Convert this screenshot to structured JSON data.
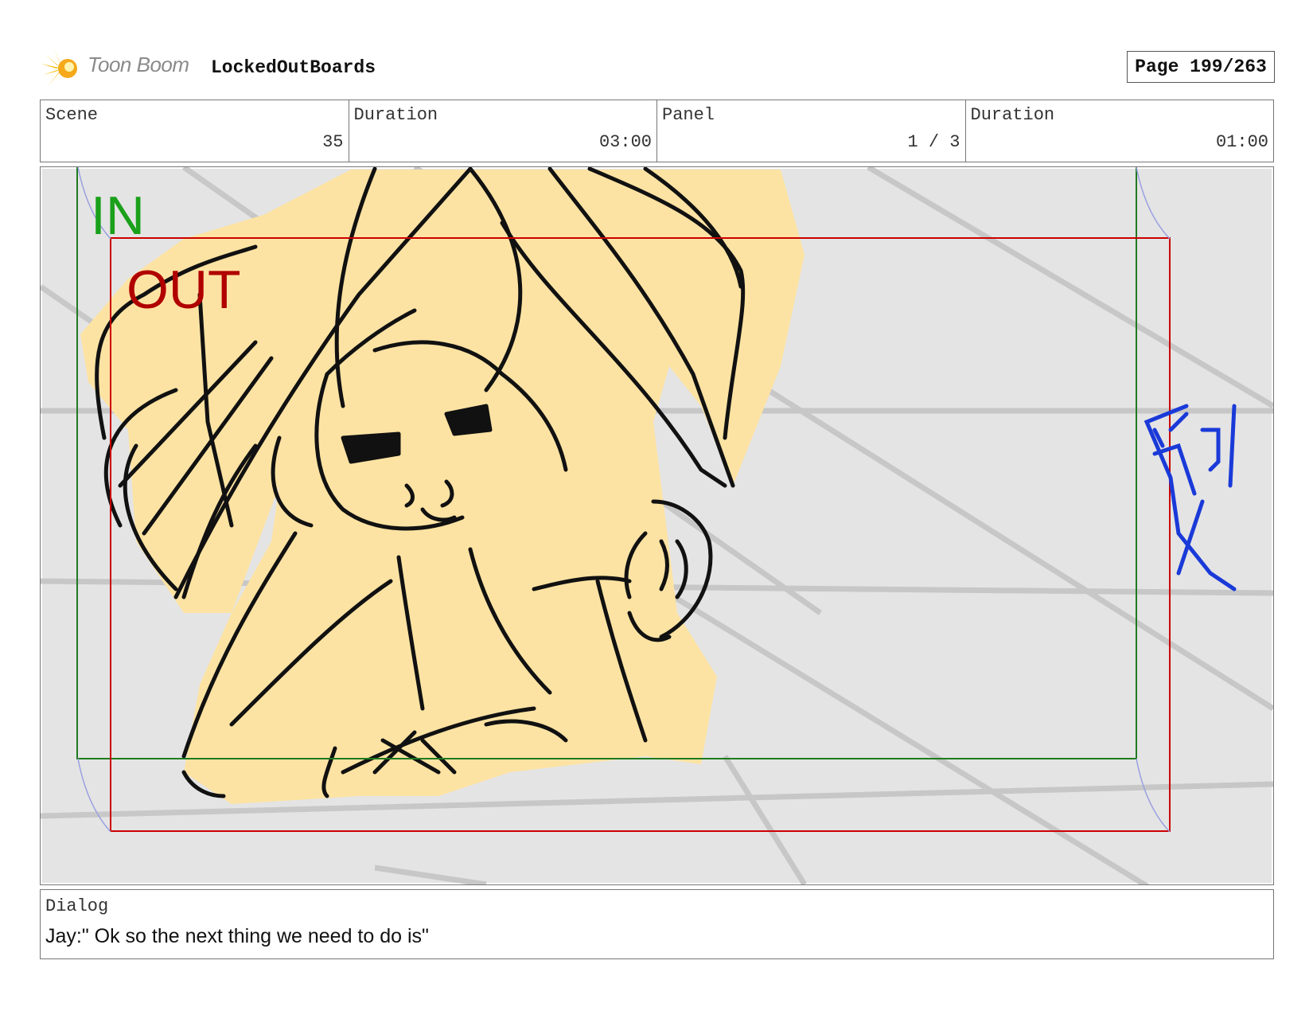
{
  "header": {
    "brand": "Toon Boom",
    "project_title": "LockedOutBoards",
    "page_label": "Page 199/263"
  },
  "info": {
    "scene_label": "Scene",
    "scene_value": "35",
    "scene_duration_label": "Duration",
    "scene_duration_value": "03:00",
    "panel_label": "Panel",
    "panel_value": "1 / 3",
    "panel_duration_label": "Duration",
    "panel_duration_value": "01:00"
  },
  "frame": {
    "in_label": "IN",
    "out_label": "OUT",
    "in_color": "#1aa01a",
    "out_color": "#b00000",
    "background_color": "#e4e4e4",
    "sketch_fill_color": "#fde3a3"
  },
  "dialog": {
    "label": "Dialog",
    "text": "Jay:\" Ok so the next thing we need to do is\""
  }
}
